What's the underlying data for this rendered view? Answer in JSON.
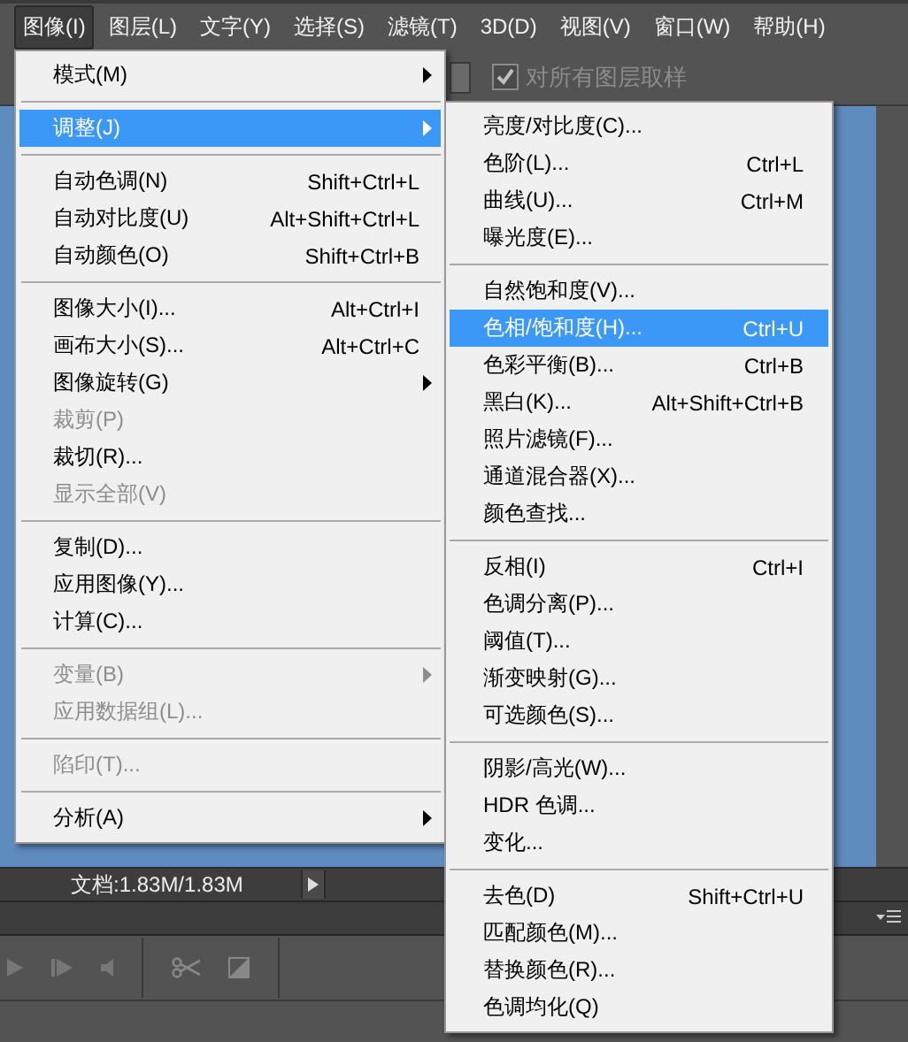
{
  "menubar": [
    {
      "label": "图像(I)",
      "selected": true
    },
    {
      "label": "图层(L)",
      "selected": false
    },
    {
      "label": "文字(Y)",
      "selected": false
    },
    {
      "label": "选择(S)",
      "selected": false
    },
    {
      "label": "滤镜(T)",
      "selected": false
    },
    {
      "label": "3D(D)",
      "selected": false
    },
    {
      "label": "视图(V)",
      "selected": false
    },
    {
      "label": "窗口(W)",
      "selected": false
    },
    {
      "label": "帮助(H)",
      "selected": false
    }
  ],
  "options_bar": {
    "sample_all_layers": {
      "label": "对所有图层取样",
      "checked": true,
      "disabled": true
    }
  },
  "image_menu": {
    "groups": [
      [
        {
          "label": "模式(M)",
          "has_submenu": true,
          "disabled": false,
          "selected": false
        }
      ],
      [
        {
          "label": "调整(J)",
          "has_submenu": true,
          "disabled": false,
          "selected": true
        }
      ],
      [
        {
          "label": "自动色调(N)",
          "shortcut": "Shift+Ctrl+L",
          "has_submenu": false,
          "disabled": false,
          "selected": false
        },
        {
          "label": "自动对比度(U)",
          "shortcut": "Alt+Shift+Ctrl+L",
          "has_submenu": false,
          "disabled": false,
          "selected": false
        },
        {
          "label": "自动颜色(O)",
          "shortcut": "Shift+Ctrl+B",
          "has_submenu": false,
          "disabled": false,
          "selected": false
        }
      ],
      [
        {
          "label": "图像大小(I)...",
          "shortcut": "Alt+Ctrl+I",
          "has_submenu": false,
          "disabled": false,
          "selected": false
        },
        {
          "label": "画布大小(S)...",
          "shortcut": "Alt+Ctrl+C",
          "has_submenu": false,
          "disabled": false,
          "selected": false
        },
        {
          "label": "图像旋转(G)",
          "has_submenu": true,
          "disabled": false,
          "selected": false
        },
        {
          "label": "裁剪(P)",
          "has_submenu": false,
          "disabled": true,
          "selected": false
        },
        {
          "label": "裁切(R)...",
          "has_submenu": false,
          "disabled": false,
          "selected": false
        },
        {
          "label": "显示全部(V)",
          "has_submenu": false,
          "disabled": true,
          "selected": false
        }
      ],
      [
        {
          "label": "复制(D)...",
          "has_submenu": false,
          "disabled": false,
          "selected": false
        },
        {
          "label": "应用图像(Y)...",
          "has_submenu": false,
          "disabled": false,
          "selected": false
        },
        {
          "label": "计算(C)...",
          "has_submenu": false,
          "disabled": false,
          "selected": false
        }
      ],
      [
        {
          "label": "变量(B)",
          "has_submenu": true,
          "disabled": true,
          "selected": false
        },
        {
          "label": "应用数据组(L)...",
          "has_submenu": false,
          "disabled": true,
          "selected": false
        }
      ],
      [
        {
          "label": "陷印(T)...",
          "has_submenu": false,
          "disabled": true,
          "selected": false
        }
      ],
      [
        {
          "label": "分析(A)",
          "has_submenu": true,
          "disabled": false,
          "selected": false
        }
      ]
    ]
  },
  "adjust_submenu": {
    "groups": [
      [
        {
          "label": "亮度/对比度(C)...",
          "has_submenu": false,
          "disabled": false,
          "selected": false
        },
        {
          "label": "色阶(L)...",
          "shortcut": "Ctrl+L",
          "has_submenu": false,
          "disabled": false,
          "selected": false
        },
        {
          "label": "曲线(U)...",
          "shortcut": "Ctrl+M",
          "has_submenu": false,
          "disabled": false,
          "selected": false
        },
        {
          "label": "曝光度(E)...",
          "has_submenu": false,
          "disabled": false,
          "selected": false
        }
      ],
      [
        {
          "label": "自然饱和度(V)...",
          "has_submenu": false,
          "disabled": false,
          "selected": false
        },
        {
          "label": "色相/饱和度(H)...",
          "shortcut": "Ctrl+U",
          "has_submenu": false,
          "disabled": false,
          "selected": true
        },
        {
          "label": "色彩平衡(B)...",
          "shortcut": "Ctrl+B",
          "has_submenu": false,
          "disabled": false,
          "selected": false
        },
        {
          "label": "黑白(K)...",
          "shortcut": "Alt+Shift+Ctrl+B",
          "has_submenu": false,
          "disabled": false,
          "selected": false
        },
        {
          "label": "照片滤镜(F)...",
          "has_submenu": false,
          "disabled": false,
          "selected": false
        },
        {
          "label": "通道混合器(X)...",
          "has_submenu": false,
          "disabled": false,
          "selected": false
        },
        {
          "label": "颜色查找...",
          "has_submenu": false,
          "disabled": false,
          "selected": false
        }
      ],
      [
        {
          "label": "反相(I)",
          "shortcut": "Ctrl+I",
          "has_submenu": false,
          "disabled": false,
          "selected": false
        },
        {
          "label": "色调分离(P)...",
          "has_submenu": false,
          "disabled": false,
          "selected": false
        },
        {
          "label": "阈值(T)...",
          "has_submenu": false,
          "disabled": false,
          "selected": false
        },
        {
          "label": "渐变映射(G)...",
          "has_submenu": false,
          "disabled": false,
          "selected": false
        },
        {
          "label": "可选颜色(S)...",
          "has_submenu": false,
          "disabled": false,
          "selected": false
        }
      ],
      [
        {
          "label": "阴影/高光(W)...",
          "has_submenu": false,
          "disabled": false,
          "selected": false
        },
        {
          "label": "HDR 色调...",
          "has_submenu": false,
          "disabled": false,
          "selected": false
        },
        {
          "label": "变化...",
          "has_submenu": false,
          "disabled": false,
          "selected": false
        }
      ],
      [
        {
          "label": "去色(D)",
          "shortcut": "Shift+Ctrl+U",
          "has_submenu": false,
          "disabled": false,
          "selected": false
        },
        {
          "label": "匹配颜色(M)...",
          "has_submenu": false,
          "disabled": false,
          "selected": false
        },
        {
          "label": "替换颜色(R)...",
          "has_submenu": false,
          "disabled": false,
          "selected": false
        },
        {
          "label": "色调均化(Q)",
          "has_submenu": false,
          "disabled": false,
          "selected": false
        }
      ]
    ]
  },
  "status_bar": {
    "doc_size": "文档:1.83M/1.83M"
  }
}
